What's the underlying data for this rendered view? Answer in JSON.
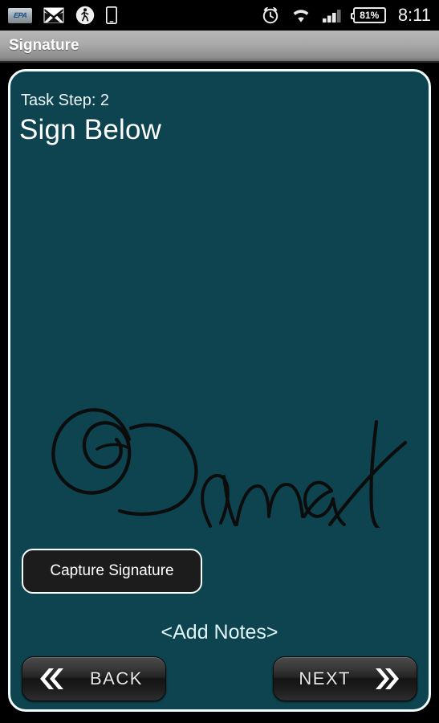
{
  "status_bar": {
    "left_icons": [
      {
        "name": "epa-logo-icon",
        "label": "EPA"
      },
      {
        "name": "mail-icon",
        "label": "envelope"
      },
      {
        "name": "pedestrian-icon",
        "label": "walking person"
      },
      {
        "name": "device-icon",
        "label": "phone"
      }
    ],
    "alarm_icon": "alarm-clock-icon",
    "wifi_icon": "wifi-icon",
    "signal_icon": "cell-signal-icon",
    "signal_bars_filled": 3,
    "signal_bars_total": 4,
    "battery_percent": "81%",
    "time": "8:11"
  },
  "title_bar": {
    "title": "Signature"
  },
  "panel": {
    "step_label": "Task Step: 2",
    "heading": "Sign Below",
    "signature_present": true,
    "signature_alt": "handwritten signature in black ink",
    "capture_button_label": "Capture Signature",
    "add_notes_label": "<Add Notes>",
    "back_button_label": "BACK",
    "next_button_label": "NEXT"
  },
  "colors": {
    "panel_teal": "#0d4450",
    "panel_border": "#f2fbfb",
    "status_bar_bg": "#000000",
    "title_bar_text": "#ffffff",
    "ink": "#0b0b0b",
    "add_notes_text": "#dff4f6"
  }
}
